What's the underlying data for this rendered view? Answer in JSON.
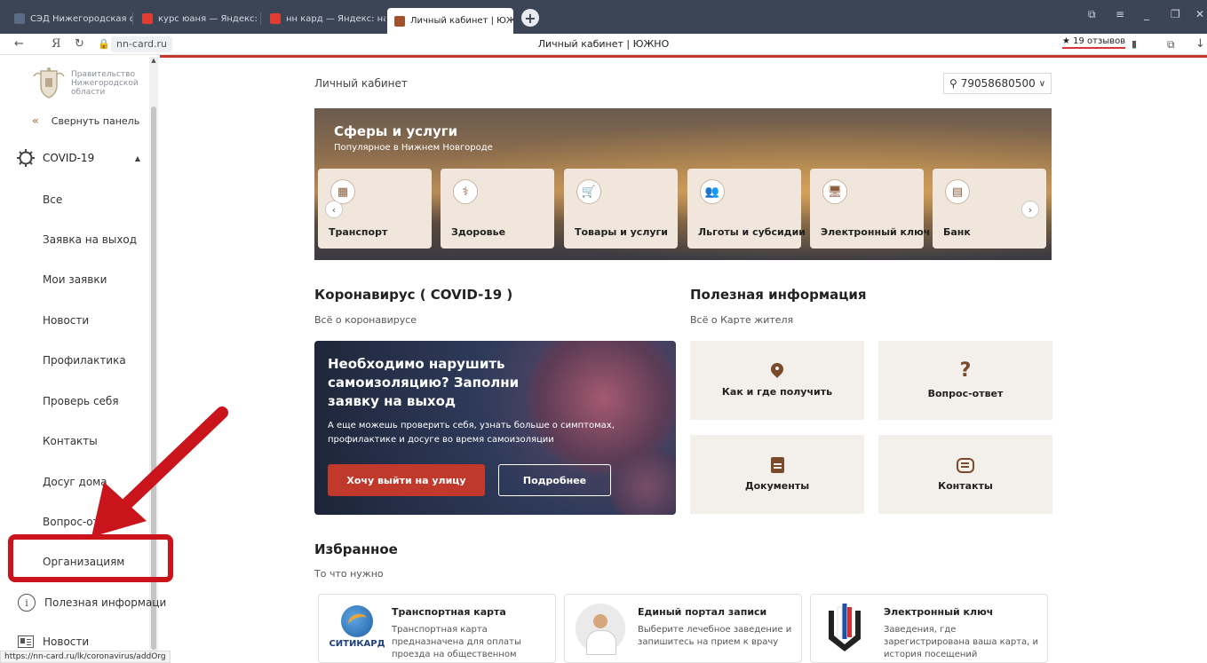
{
  "browser": {
    "tabs": [
      {
        "label": "СЭД Нижегородская обла",
        "color": "#5b6b86"
      },
      {
        "label": "курс юаня — Яндекс: наш",
        "color": "#e03c31"
      },
      {
        "label": "нн кард — Яндекс: нашло",
        "color": "#e03c31"
      },
      {
        "label": "Личный кабинет | ЮЖН",
        "color": "#a0522d"
      }
    ],
    "url_host": "nn-card.ru",
    "page_title": "Личный кабинет | ЮЖНО",
    "reviews_star": "★",
    "reviews_count": "19 отзывов",
    "status_url": "https://nn-card.ru/lk/coronavirus/addOrg"
  },
  "sidebar": {
    "logo_text": "Правительство Нижегородской области",
    "collapse_icon": "«",
    "collapse_label": "Свернуть панель",
    "covid_label": "COVID-19",
    "covid_items": [
      "Все",
      "Заявка на выход",
      "Мои заявки",
      "Новости",
      "Профилактика",
      "Проверь себя",
      "Контакты",
      "Досуг дома",
      "Вопрос-ответ",
      "Организациям"
    ],
    "useful_label": "Полезная информаци",
    "news_label": "Новости"
  },
  "header": {
    "breadcrumb": "Личный кабинет",
    "account_phone": "79058680500"
  },
  "banner": {
    "title": "Сферы и услуги",
    "subtitle": "Популярное в Нижнем Новгороде",
    "services": [
      "Транспорт",
      "Здоровье",
      "Товары и услуги",
      "Льготы и субсидии",
      "Электронный ключ",
      "Банк"
    ]
  },
  "covid_section": {
    "title": "Коронавирус ( COVID-19 )",
    "subtitle": "Всё о коронавирусе",
    "card_title": "Необходимо нарушить самоизоляцию? Заполни заявку на выход",
    "card_text": "А еще можешь проверить себя, узнать больше о симптомах, профилактике и досуге во время самоизоляции",
    "primary_button": "Хочу выйти на улицу",
    "secondary_button": "Подробнее"
  },
  "useful_section": {
    "title": "Полезная информация",
    "subtitle": "Всё о Карте жителя",
    "tiles": [
      {
        "label": "Как и где получить",
        "icon": "map-pin-icon"
      },
      {
        "label": "Вопрос-ответ",
        "icon": "question-icon"
      },
      {
        "label": "Документы",
        "icon": "document-icon"
      },
      {
        "label": "Контакты",
        "icon": "chat-icon"
      }
    ],
    "question_glyph": "?"
  },
  "favorites": {
    "title": "Избранное",
    "subtitle": "То что нужно",
    "cards": [
      {
        "title": "Транспортная карта",
        "text": "Транспортная карта предназначена для оплаты проезда на общественном транспорте,",
        "logo_word": "СИТИКАРД"
      },
      {
        "title": "Единый портал записи",
        "text": "Выберите лечебное заведение и запишитесь на прием к врачу"
      },
      {
        "title": "Электронный ключ",
        "text": "Заведения, где зарегистрирована ваша карта, и история посещений"
      }
    ]
  },
  "colors": {
    "accent_red": "#c0392b",
    "highlight_red": "#c8141a",
    "brand_brown": "#7a4a2c"
  }
}
